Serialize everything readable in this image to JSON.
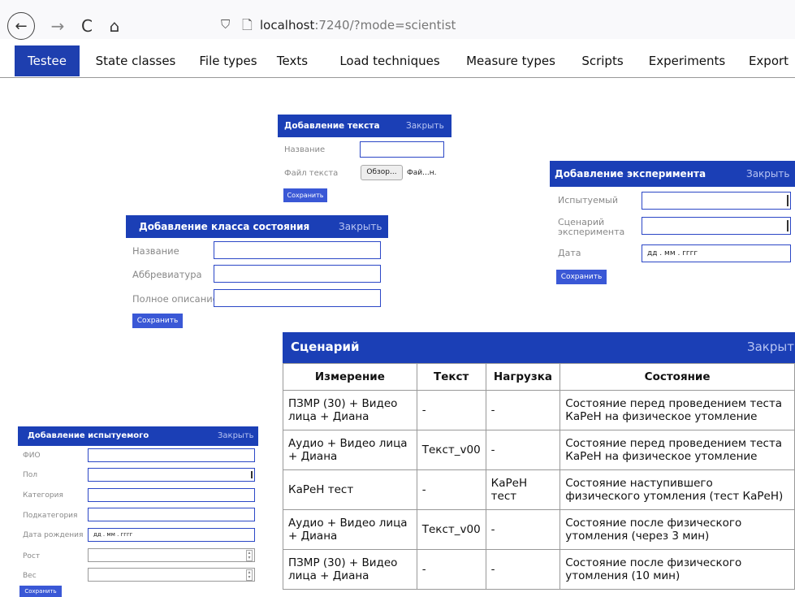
{
  "browser": {
    "back_icon": "←",
    "forward_icon": "→",
    "reload_icon": "C",
    "home_icon": "⌂",
    "url_host": "localhost",
    "url_rest": ":7240/?mode=scientist"
  },
  "tabs": [
    {
      "label": "Testee",
      "active": true
    },
    {
      "label": "State classes"
    },
    {
      "label": "File types"
    },
    {
      "label": "Texts"
    },
    {
      "label": "Load techniques"
    },
    {
      "label": "Measure types"
    },
    {
      "label": "Scripts"
    },
    {
      "label": "Experiments"
    },
    {
      "label": "Export"
    }
  ],
  "add_text": {
    "title": "Добавление текста",
    "close": "Закрыть",
    "name_label": "Название",
    "file_label": "Файл текста",
    "browse": "Обзор...",
    "file_value": "Фай...н.",
    "save": "Сохранить"
  },
  "add_state_class": {
    "title": "Добавление класса состояния",
    "close": "Закрыть",
    "name_label": "Название",
    "abbr_label": "Аббревиатура",
    "desc_label": "Полное описание",
    "save": "Сохранить"
  },
  "add_experiment": {
    "title": "Добавление эксперимента",
    "close": "Закрыть",
    "testee_label": "Испытуемый",
    "script_label_1": "Сценарий",
    "script_label_2": "эксперимента",
    "date_label": "Дата",
    "date_placeholder": "дд . мм . гггг",
    "save": "Сохранить"
  },
  "add_testee": {
    "title": "Добавление испытуемого",
    "close": "Закрыть",
    "fio_label": "ФИО",
    "sex_label": "Пол",
    "category_label": "Категория",
    "subcategory_label": "Подкатегория",
    "birth_label": "Дата рождения",
    "birth_placeholder": "дд . мм . гггг",
    "height_label": "Рост",
    "weight_label": "Вес",
    "save": "Сохранить"
  },
  "scenario": {
    "title": "Сценарий",
    "close": "Закрыть",
    "headers": [
      "Измерение",
      "Текст",
      "Нагрузка",
      "Состояние"
    ],
    "rows": [
      {
        "measure": "ПЗМР (30) + Видео лица + Диана",
        "text": "-",
        "load": "-",
        "state": "Состояние перед проведением теста КаРеН на физическое утомление"
      },
      {
        "measure": "Аудио + Видео лица + Диана",
        "text": "Текст_v00",
        "load": "-",
        "state": "Состояние перед проведением теста КаРеН на физическое утомление"
      },
      {
        "measure": "КаРеН тест",
        "text": "-",
        "load": "КаРеН тест",
        "state": "Состояние наступившего физического утомления (тест КаРеН)"
      },
      {
        "measure": "Аудио + Видео лица + Диана",
        "text": "Текст_v00",
        "load": "-",
        "state": "Состояние после физического утомления (через 3 мин)"
      },
      {
        "measure": "ПЗМР (30) + Видео лица + Диана",
        "text": "-",
        "load": "-",
        "state": "Состояние после физического утомления (10 мин)"
      }
    ]
  }
}
